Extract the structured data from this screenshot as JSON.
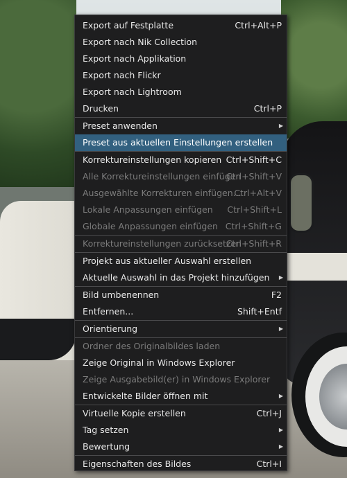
{
  "menu": {
    "items": [
      {
        "label": "Export auf Festplatte",
        "shortcut": "Ctrl+Alt+P"
      },
      {
        "label": "Export nach Nik Collection",
        "shortcut": ""
      },
      {
        "label": "Export nach Applikation",
        "shortcut": ""
      },
      {
        "label": "Export nach Flickr",
        "shortcut": ""
      },
      {
        "label": "Export nach Lightroom",
        "shortcut": ""
      },
      {
        "label": "Drucken",
        "shortcut": "Ctrl+P"
      },
      {
        "label": "Preset anwenden",
        "shortcut": ""
      },
      {
        "label": "Preset aus aktuellen Einstellungen erstellen",
        "shortcut": ""
      },
      {
        "label": "Korrektureinstellungen kopieren",
        "shortcut": "Ctrl+Shift+C"
      },
      {
        "label": "Alle Korrektureinstellungen einfügen",
        "shortcut": "Ctrl+Shift+V"
      },
      {
        "label": "Ausgewählte Korrekturen einfügen...",
        "shortcut": "Ctrl+Alt+V"
      },
      {
        "label": "Lokale Anpassungen einfügen",
        "shortcut": "Ctrl+Shift+L"
      },
      {
        "label": "Globale Anpassungen einfügen",
        "shortcut": "Ctrl+Shift+G"
      },
      {
        "label": "Korrektureinstellungen zurücksetzen",
        "shortcut": "Ctrl+Shift+R"
      },
      {
        "label": "Projekt aus aktueller Auswahl erstellen",
        "shortcut": ""
      },
      {
        "label": "Aktuelle Auswahl in das Projekt hinzufügen",
        "shortcut": ""
      },
      {
        "label": "Bild umbenennen",
        "shortcut": "F2"
      },
      {
        "label": "Entfernen...",
        "shortcut": "Shift+Entf"
      },
      {
        "label": "Orientierung",
        "shortcut": ""
      },
      {
        "label": "Ordner des Originalbildes laden",
        "shortcut": ""
      },
      {
        "label": "Zeige Original in Windows Explorer",
        "shortcut": ""
      },
      {
        "label": "Zeige Ausgabebild(er) in Windows Explorer",
        "shortcut": ""
      },
      {
        "label": "Entwickelte Bilder öffnen mit",
        "shortcut": ""
      },
      {
        "label": "Virtuelle Kopie erstellen",
        "shortcut": "Ctrl+J"
      },
      {
        "label": "Tag setzen",
        "shortcut": ""
      },
      {
        "label": "Bewertung",
        "shortcut": ""
      },
      {
        "label": "Eigenschaften des Bildes",
        "shortcut": "Ctrl+I"
      }
    ],
    "submenu_arrow_glyph": "▶"
  },
  "colors": {
    "menu_bg": "#1e1e1f",
    "highlight": "#32607f",
    "text": "#e8e8e8",
    "disabled_text": "#7b7b7b",
    "separator": "#4a4a4c"
  }
}
